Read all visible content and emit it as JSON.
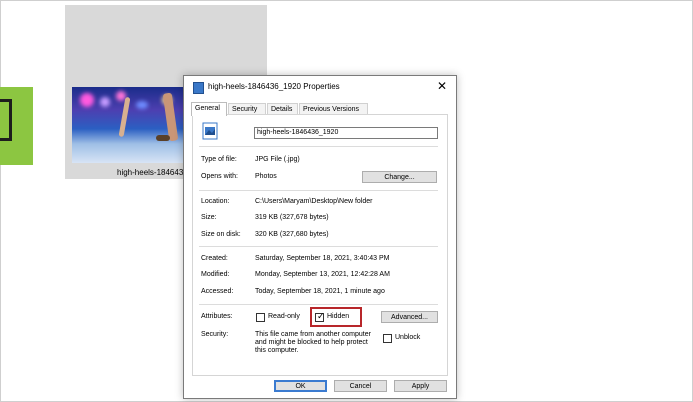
{
  "thumbnail": {
    "caption": "high-heels-1846436_1920"
  },
  "dialog": {
    "title": "high-heels-1846436_1920 Properties",
    "close_glyph": "✕",
    "tabs": [
      {
        "label": "General"
      },
      {
        "label": "Security"
      },
      {
        "label": "Details"
      },
      {
        "label": "Previous Versions"
      }
    ],
    "filename": "high-heels-1846436_1920",
    "type_label": "Type of file:",
    "type_value": "JPG File (.jpg)",
    "opens_label": "Opens with:",
    "opens_value": "Photos",
    "change_button": "Change...",
    "location_label": "Location:",
    "location_value": "C:\\Users\\Maryam\\Desktop\\New folder",
    "size_label": "Size:",
    "size_value": "319 KB (327,678 bytes)",
    "size_disk_label": "Size on disk:",
    "size_disk_value": "320 KB (327,680 bytes)",
    "created_label": "Created:",
    "created_value": "Saturday, September 18, 2021, 3:40:43 PM",
    "modified_label": "Modified:",
    "modified_value": "Monday, September 13, 2021, 12:42:28 AM",
    "accessed_label": "Accessed:",
    "accessed_value": "Today, September 18, 2021, 1 minute ago",
    "attributes_label": "Attributes:",
    "readonly_label": "Read-only",
    "readonly_checked": false,
    "hidden_label": "Hidden",
    "hidden_checked": true,
    "advanced_button": "Advanced...",
    "security_label": "Security:",
    "security_text": "This file came from another computer and might be blocked to help protect this computer.",
    "unblock_label": "Unblock",
    "unblock_checked": false,
    "ok_button": "OK",
    "cancel_button": "Cancel",
    "apply_button": "Apply"
  },
  "colors": {
    "accent": "#3b7bd0",
    "highlight": "#b8262a",
    "green": "#8cc641"
  },
  "icons": {
    "file": "image-file-icon",
    "checkmark": "✓"
  }
}
